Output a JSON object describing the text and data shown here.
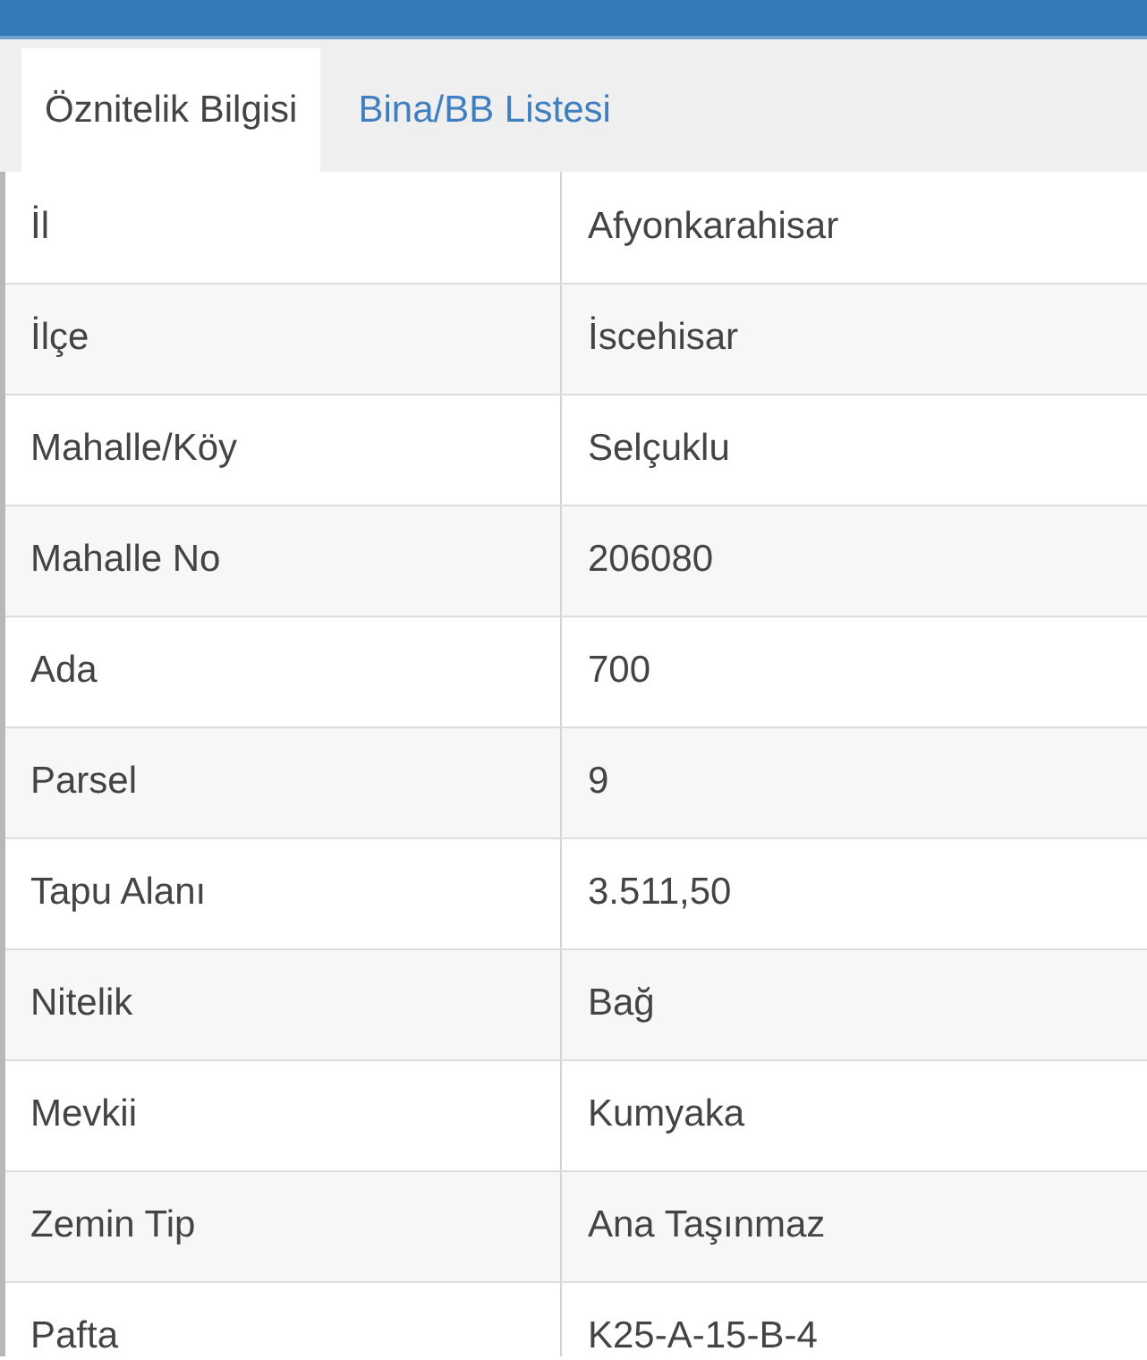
{
  "tabs": [
    {
      "label": "Öznitelik Bilgisi",
      "selected": true
    },
    {
      "label": "Bina/BB Listesi",
      "selected": false
    }
  ],
  "rows": [
    {
      "label": "İl",
      "value": "Afyonkarahisar"
    },
    {
      "label": "İlçe",
      "value": "İscehisar"
    },
    {
      "label": "Mahalle/Köy",
      "value": "Selçuklu"
    },
    {
      "label": "Mahalle No",
      "value": "206080"
    },
    {
      "label": "Ada",
      "value": "700"
    },
    {
      "label": "Parsel",
      "value": "9"
    },
    {
      "label": "Tapu Alanı",
      "value": "3.511,50"
    },
    {
      "label": "Nitelik",
      "value": "Bağ"
    },
    {
      "label": "Mevkii",
      "value": "Kumyaka"
    },
    {
      "label": "Zemin Tip",
      "value": "Ana Taşınmaz"
    },
    {
      "label": "Pafta",
      "value": "K25-A-15-B-4"
    }
  ]
}
